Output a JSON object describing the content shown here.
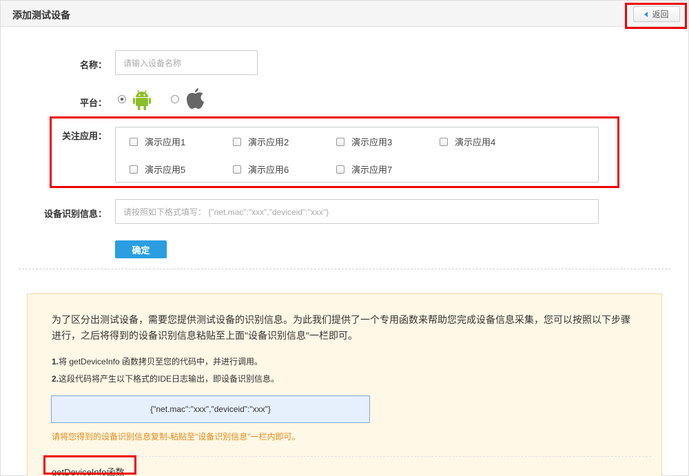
{
  "header": {
    "title": "添加测试设备",
    "back_label": "返回"
  },
  "form": {
    "name_label": "名称：",
    "name_placeholder": "请输入设备名称",
    "platform_label": "平台：",
    "platform_options": [
      {
        "icon": "android-icon",
        "checked": true
      },
      {
        "icon": "apple-icon",
        "checked": false
      }
    ],
    "apps_label": "关注应用：",
    "apps": [
      "演示应用1",
      "演示应用2",
      "演示应用3",
      "演示应用4",
      "演示应用5",
      "演示应用6",
      "演示应用7"
    ],
    "device_info_label": "设备识别信息：",
    "device_info_placeholder": "请按照如下格式填写：  {\"net.mac\":\"xxx\",\"deviceid\":\"xxx\"}",
    "confirm_label": "确定"
  },
  "info": {
    "paragraph": "为了区分出测试设备，需要您提供测试设备的识别信息。为此我们提供了一个专用函数来帮助您完成设备信息采集，您可以按照以下步骤进行，之后将得到的设备识别信息粘贴至上面\"设备识别信息\"一栏即可。",
    "step1_num": "1.",
    "step1_text": "将 getDeviceInfo 函数拷贝至您的代码中，并进行调用。",
    "step2_num": "2.",
    "step2_text": "这段代码将产生以下格式的IDE日志输出，即设备识别信息。",
    "code_sample": "{\"net.mac\":\"xxx\",\"deviceid\":\"xxx\"}",
    "tip": "请将您得到的设备识别信息复制-粘贴至\"设备识别信息\"一栏内即可。",
    "function_title": "getDeviceInfo函数"
  },
  "colors": {
    "accent": "#2a9ee0",
    "highlight": "#e00000",
    "tip": "#e28a1b",
    "android": "#8dbe2b",
    "apple": "#666666"
  }
}
